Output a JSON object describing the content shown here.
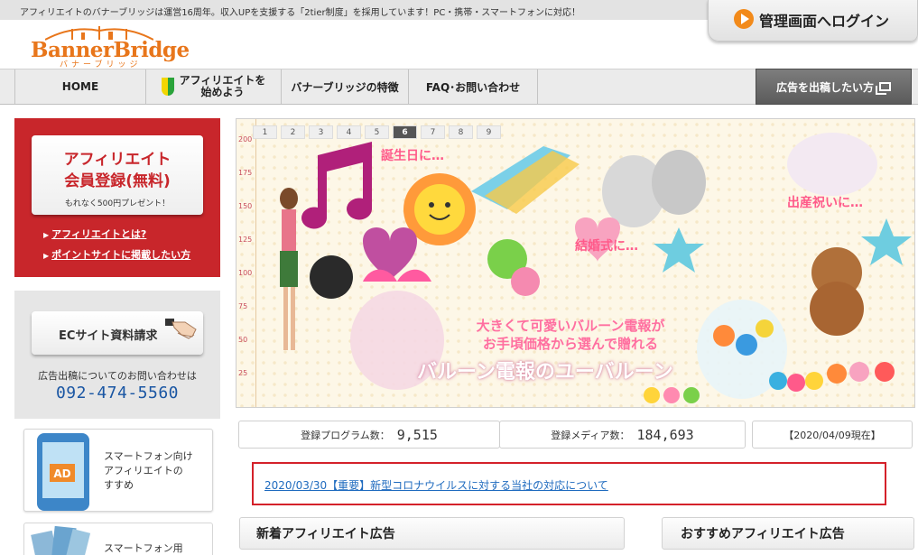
{
  "header": {
    "notice": "アフィリエイトのバナーブリッジは運営16周年。収入UPを支援する「2tier制度」を採用しています！PC・携帯・スマートフォンに対応！",
    "login_label": "管理画面へログイン",
    "logo_text": "BannerBridge",
    "logo_sub": "バナーブリッジ"
  },
  "nav": {
    "items": [
      {
        "label": "HOME"
      },
      {
        "label_line1": "アフィリエイトを",
        "label_line2": "始めよう"
      },
      {
        "label": "バナーブリッジの特徴"
      },
      {
        "label": "FAQ･お問い合わせ"
      }
    ],
    "advertiser_button": "広告を出稿したい方"
  },
  "sidebar": {
    "register": {
      "line1": "アフィリエイト",
      "line2": "会員登録(無料)",
      "line3": "もれなく500円プレゼント！"
    },
    "links": [
      "アフィリエイトとは?",
      "ポイントサイトに掲載したい方"
    ],
    "ec_button": "ECサイト資料請求",
    "contact_label": "広告出稿についてのお問い合わせは",
    "contact_phone": "092-474-5560",
    "smartphone_banner": {
      "line1": "スマートフォン向け",
      "line2": "アフィリエイトの",
      "line3": "すすめ"
    },
    "smartphone_banner2": "スマートフォン用"
  },
  "hero": {
    "pages": [
      "1",
      "2",
      "3",
      "4",
      "5",
      "6",
      "7",
      "8",
      "9"
    ],
    "active_page": "6",
    "ruler": [
      "200",
      "175",
      "150",
      "125",
      "100",
      "75",
      "50",
      "25"
    ],
    "tag_birthday": "誕生日に…",
    "tag_wedding": "結婚式に…",
    "tag_baby": "出産祝いに…",
    "copy_line1": "大きくて可愛いバルーン電報が",
    "copy_line2": "お手頃価格から選んで贈れる",
    "copy_main": "バルーン電報のユーバルーン"
  },
  "stats": {
    "programs_label": "登録プログラム数：",
    "programs_value": "9,515",
    "media_label": "登録メディア数：",
    "media_value": "184,693",
    "as_of": "【2020/04/09現在】"
  },
  "news": {
    "headline": "2020/03/30【重要】新型コロナウイルスに対する当社の対応について"
  },
  "sections": {
    "new_ads": "新着アフィリエイト広告",
    "recommended_ads": "おすすめアフィリエイト広告"
  },
  "colors": {
    "brand_orange": "#e8761b",
    "register_red": "#c8262b",
    "link_blue": "#1f6bbf",
    "phone_blue": "#1a56a3"
  }
}
